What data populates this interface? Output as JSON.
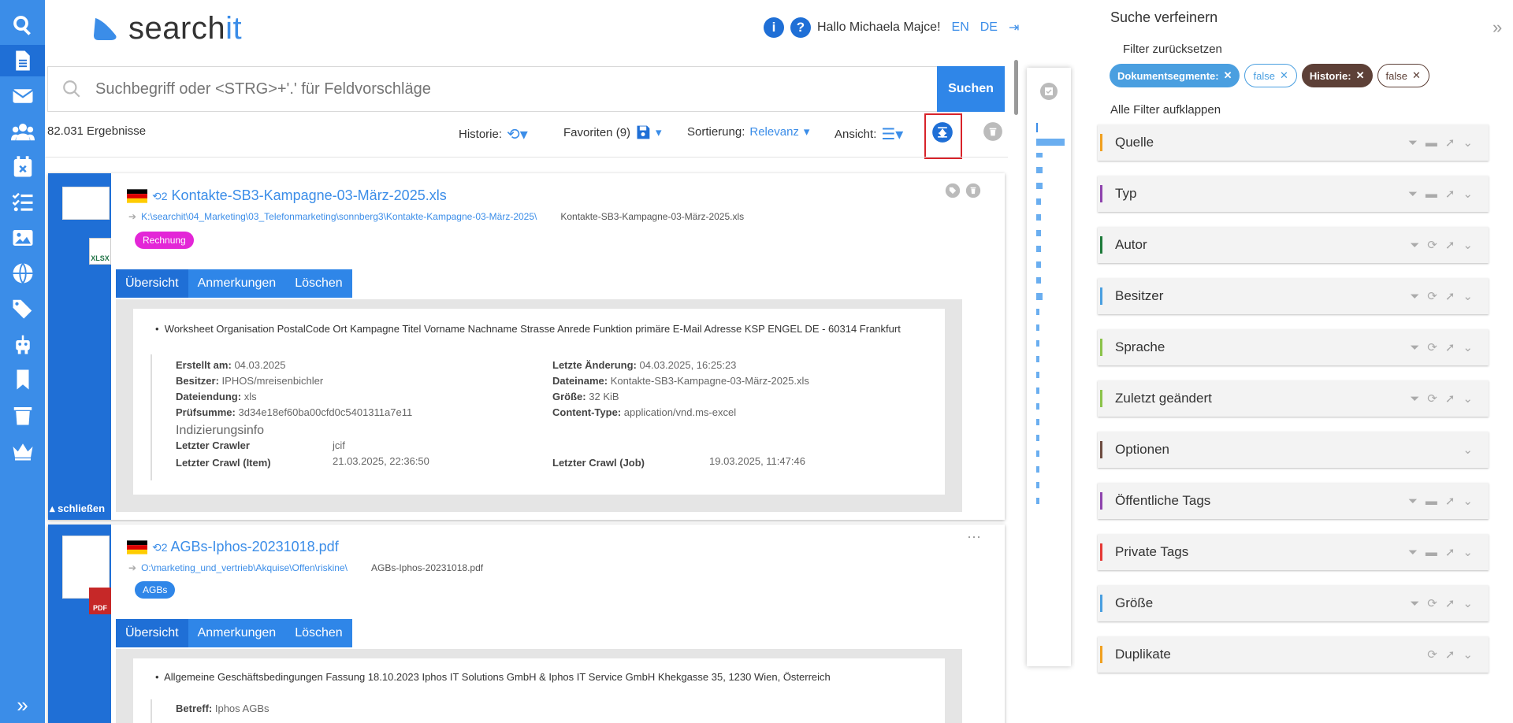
{
  "app": {
    "logo_text": "search",
    "logo_accent": "it",
    "greeting": "Hallo Michaela Majce!",
    "lang_en": "EN",
    "lang_de": "DE"
  },
  "search": {
    "placeholder": "Suchbegriff oder <STRG>+'.' für Feldvorschläge",
    "button": "Suchen"
  },
  "toolbar": {
    "results": "82.031 Ergebnisse",
    "history": "Historie:",
    "favorites": "Favoriten (9)",
    "sort_label": "Sortierung:",
    "sort_value": "Relevanz",
    "view": "Ansicht:"
  },
  "results": [
    {
      "title": "Kontakte-SB3-Kampagne-03-März-2025.xls",
      "hist": "2",
      "path": "K:\\searchit\\04_Marketing\\03_Telefonmarketing\\sonnberg3\\Kontakte-Kampagne-03-März-2025\\",
      "filename": "Kontakte-SB3-Kampagne-03-März-2025.xls",
      "ftype": "XLSX",
      "tag": "Rechnung",
      "tag_color": "#e326d7",
      "tabs": [
        "Übersicht",
        "Anmerkungen",
        "Löschen"
      ],
      "snippet": "Worksheet Organisation PostalCode Ort Kampagne Titel Vorname Nachname Strasse Anrede Funktion primäre E-Mail Adresse KSP ENGEL DE - 60314 Frankfurt",
      "meta": {
        "created_l": "Erstellt am:",
        "created_v": "04.03.2025",
        "owner_l": "Besitzer:",
        "owner_v": "IPHOS/mreisenbichler",
        "ext_l": "Dateiendung:",
        "ext_v": "xls",
        "hash_l": "Prüfsumme:",
        "hash_v": "3d34e18ef60ba00cfd0c5401311a7e11",
        "mod_l": "Letzte Änderung:",
        "mod_v": "04.03.2025, 16:25:23",
        "fname_l": "Dateiname:",
        "fname_v": "Kontakte-SB3-Kampagne-03-März-2025.xls",
        "size_l": "Größe:",
        "size_v": "32 KiB",
        "ctype_l": "Content-Type:",
        "ctype_v": "application/vnd.ms-excel",
        "index_h": "Indizierungsinfo",
        "crawler_l": "Letzter Crawler",
        "crawler_v": "jcif",
        "crawl_item_l": "Letzter Crawl (Item)",
        "crawl_item_v": "21.03.2025, 22:36:50",
        "crawl_job_l": "Letzter Crawl (Job)",
        "crawl_job_v": "19.03.2025, 11:47:46"
      },
      "close": "schließen"
    },
    {
      "title": "AGBs-Iphos-20231018.pdf",
      "hist": "2",
      "path": "O:\\marketing_und_vertrieb\\Akquise\\Offen\\riskine\\",
      "filename": "AGBs-Iphos-20231018.pdf",
      "ftype": "PDF",
      "tag": "AGBs",
      "tag_color": "#2f86e8",
      "tabs": [
        "Übersicht",
        "Anmerkungen",
        "Löschen"
      ],
      "snippet": "Allgemeine Geschäftsbedingungen Fassung 18.10.2023 Iphos IT Solutions GmbH & Iphos IT Service GmbH Khekgasse 35, 1230 Wien, Österreich",
      "meta": {
        "subject_l": "Betreff:",
        "subject_v": "Iphos AGBs"
      }
    }
  ],
  "refine": {
    "title": "Suche verfeinern",
    "reset": "Filter zurücksetzen",
    "chips": [
      {
        "label": "Dokumentsegmente:",
        "style": "blue"
      },
      {
        "label": "false",
        "style": "outline-blue"
      },
      {
        "label": "Historie:",
        "style": "brown"
      },
      {
        "label": "false",
        "style": "outline-brown"
      }
    ],
    "expand_all": "Alle Filter aufklappen",
    "facets": [
      {
        "name": "Quelle",
        "color": "#f0a020"
      },
      {
        "name": "Typ",
        "color": "#8e44ad"
      },
      {
        "name": "Autor",
        "color": "#1e7a3a"
      },
      {
        "name": "Besitzer",
        "color": "#4a9fe0"
      },
      {
        "name": "Sprache",
        "color": "#8bc34a"
      },
      {
        "name": "Zuletzt geändert",
        "color": "#8bc34a"
      },
      {
        "name": "Optionen",
        "color": "#6d4c41"
      },
      {
        "name": "Öffentliche Tags",
        "color": "#8e44ad"
      },
      {
        "name": "Private Tags",
        "color": "#e53935"
      },
      {
        "name": "Größe",
        "color": "#4a9fe0"
      },
      {
        "name": "Duplikate",
        "color": "#f0a020"
      }
    ]
  }
}
